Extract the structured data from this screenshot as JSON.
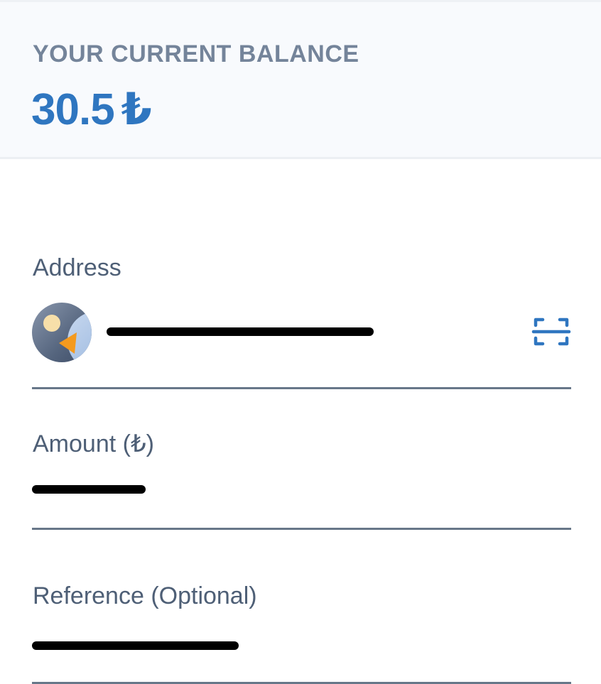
{
  "balance": {
    "label": "YOUR CURRENT BALANCE",
    "amount": "30.5",
    "currency_symbol": "₺",
    "accent_color": "#2f76c0"
  },
  "form": {
    "address": {
      "label": "Address",
      "value_redacted": true,
      "avatar_icon": "contact-avatar-icon",
      "scan_icon": "qr-scan-icon"
    },
    "amount": {
      "label": "Amount (₺)",
      "value_redacted": true
    },
    "reference": {
      "label": "Reference (Optional)",
      "value_redacted": true
    }
  }
}
